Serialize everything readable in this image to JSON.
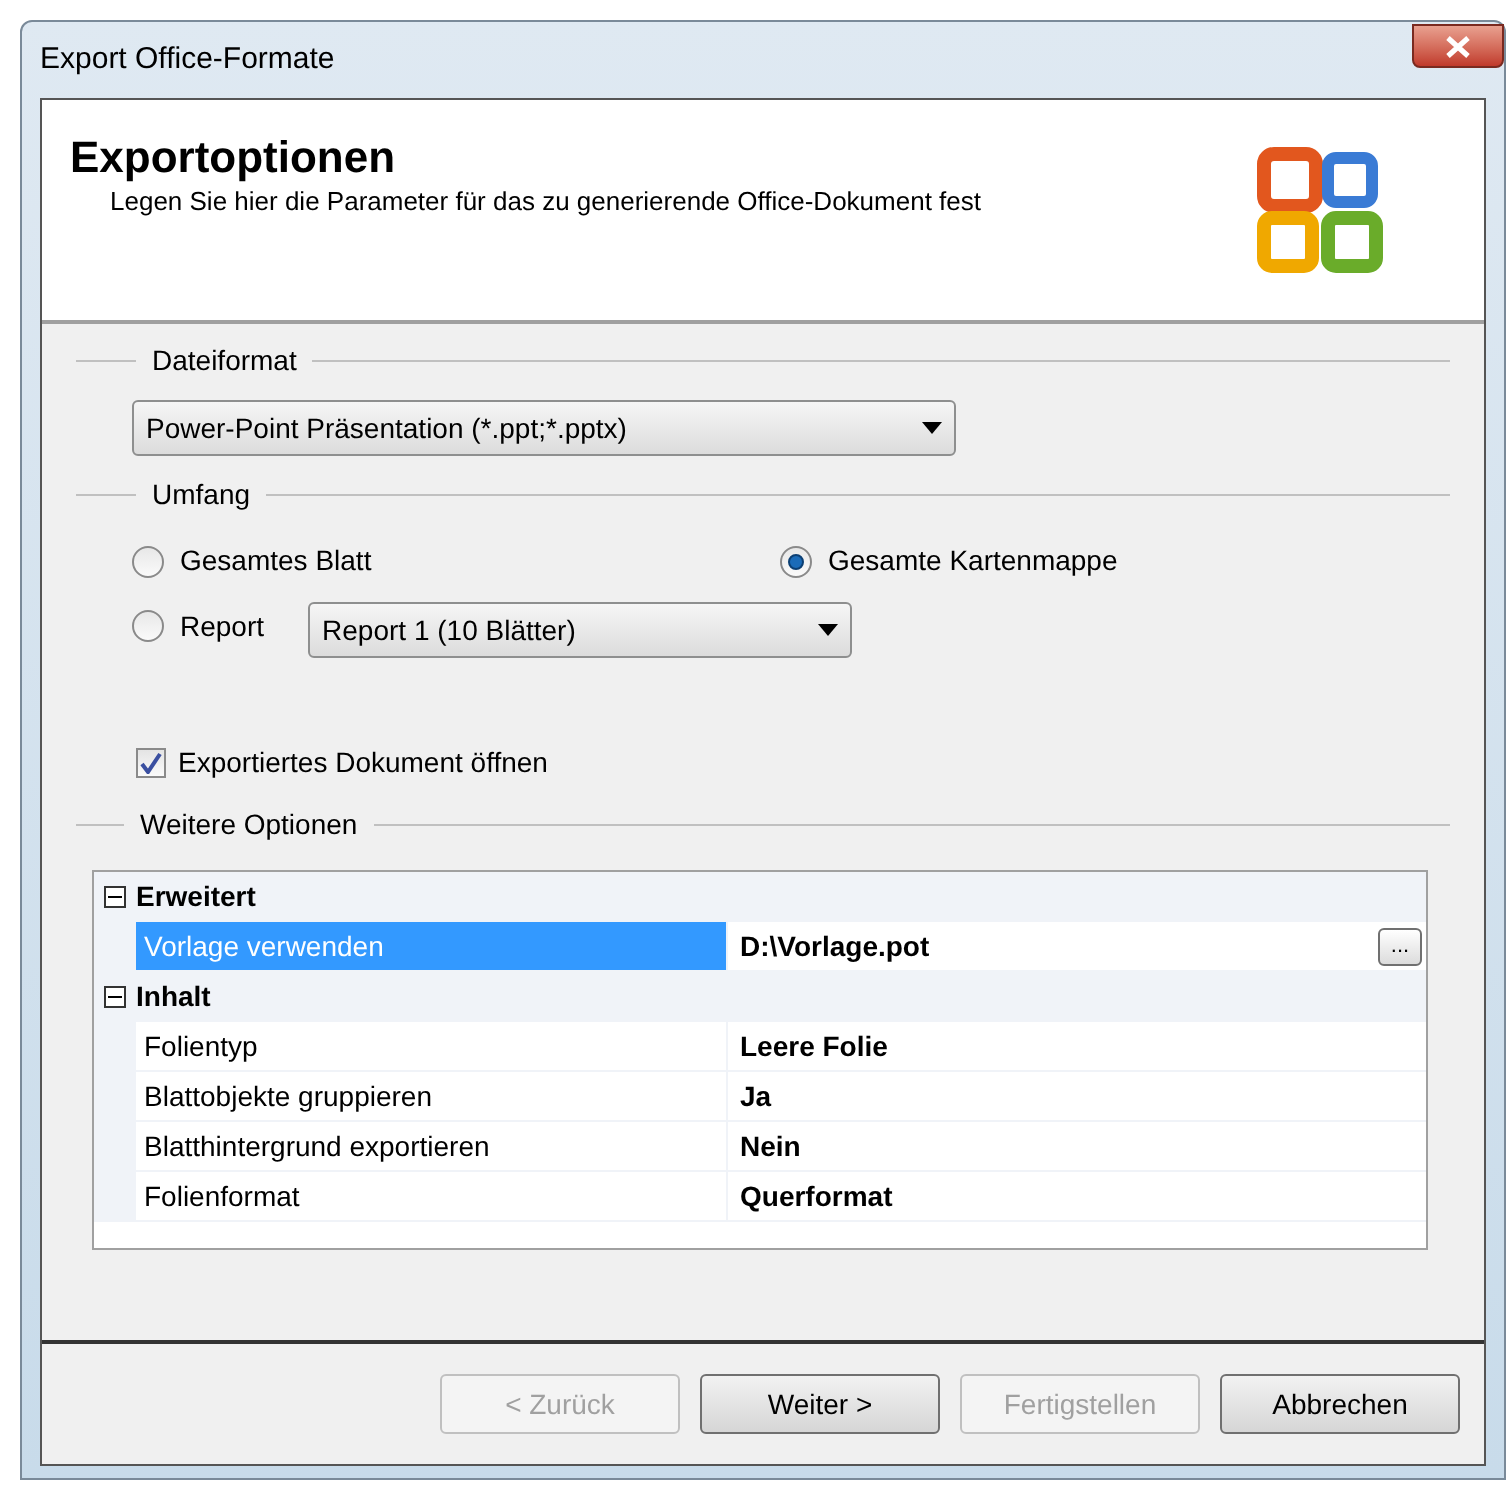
{
  "window": {
    "title": "Export Office-Formate"
  },
  "header": {
    "title": "Exportoptionen",
    "description": "Legen Sie hier die Parameter für das zu generierende Office-Dokument fest"
  },
  "file_format": {
    "legend": "Dateiformat",
    "value": "Power-Point Präsentation (*.ppt;*.pptx)"
  },
  "scope": {
    "legend": "Umfang",
    "options": [
      {
        "label": "Gesamtes Blatt",
        "selected": false
      },
      {
        "label": "Gesamte Kartenmappe",
        "selected": true
      },
      {
        "label": "Report",
        "selected": false
      }
    ],
    "report_value": "Report 1 (10 Blätter)"
  },
  "open_document": {
    "label": "Exportiertes Dokument öffnen",
    "checked": true
  },
  "more_options": {
    "legend": "Weitere Optionen",
    "categories": [
      {
        "name": "Erweitert",
        "expanded": true,
        "properties": [
          {
            "name": "Vorlage verwenden",
            "value": "D:\\Vorlage.pot",
            "selected": true,
            "button": "..."
          }
        ]
      },
      {
        "name": "Inhalt",
        "expanded": true,
        "properties": [
          {
            "name": "Folientyp",
            "value": "Leere Folie",
            "selected": false
          },
          {
            "name": "Blattobjekte gruppieren",
            "value": "Ja",
            "selected": false
          },
          {
            "name": "Blatthintergrund exportieren",
            "value": "Nein",
            "selected": false
          },
          {
            "name": "Folienformat",
            "value": "Querformat",
            "selected": false
          }
        ]
      }
    ]
  },
  "buttons": [
    {
      "label": "< Zurück",
      "disabled": true
    },
    {
      "label": "Weiter >",
      "disabled": false
    },
    {
      "label": "Fertigstellen",
      "disabled": true
    },
    {
      "label": "Abbrechen",
      "disabled": false
    }
  ]
}
